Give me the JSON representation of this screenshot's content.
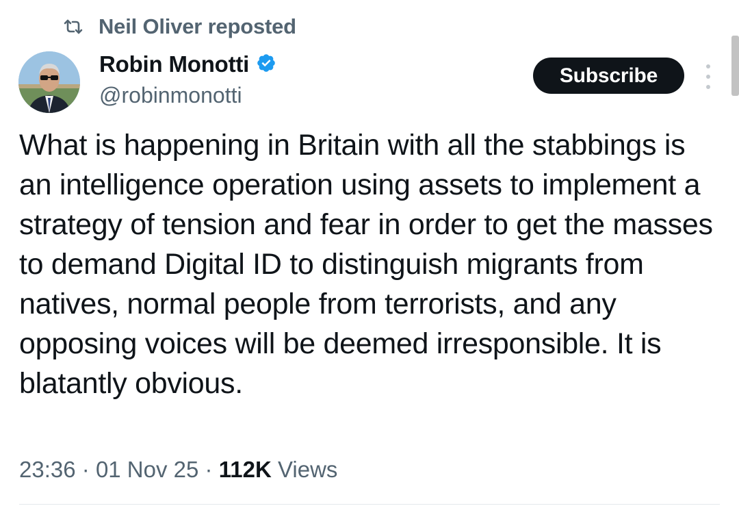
{
  "repost": {
    "text": "Neil Oliver reposted",
    "icon": "repost-icon"
  },
  "author": {
    "display_name": "Robin Monotti",
    "handle": "@robinmonotti",
    "verified": true,
    "verified_color": "#1d9bf0",
    "avatar_icon": "avatar"
  },
  "actions": {
    "subscribe_label": "Subscribe",
    "more_icon": "more-vertical-icon"
  },
  "post": {
    "text": "What is happening in Britain with all the stabbings is an intelligence operation using assets to implement a strategy of tension and fear in order to get the masses to demand Digital ID to distinguish migrants from natives, normal people from terrorists, and any opposing voices will be deemed irresponsible. It is blatantly obvious."
  },
  "meta": {
    "time": "23:36",
    "separator": "·",
    "date": "01 Nov 25",
    "views_count": "112K",
    "views_label": "Views"
  },
  "colors": {
    "text_primary": "#0f1419",
    "text_secondary": "#536471",
    "button_bg": "#0f1419",
    "button_text": "#ffffff"
  }
}
